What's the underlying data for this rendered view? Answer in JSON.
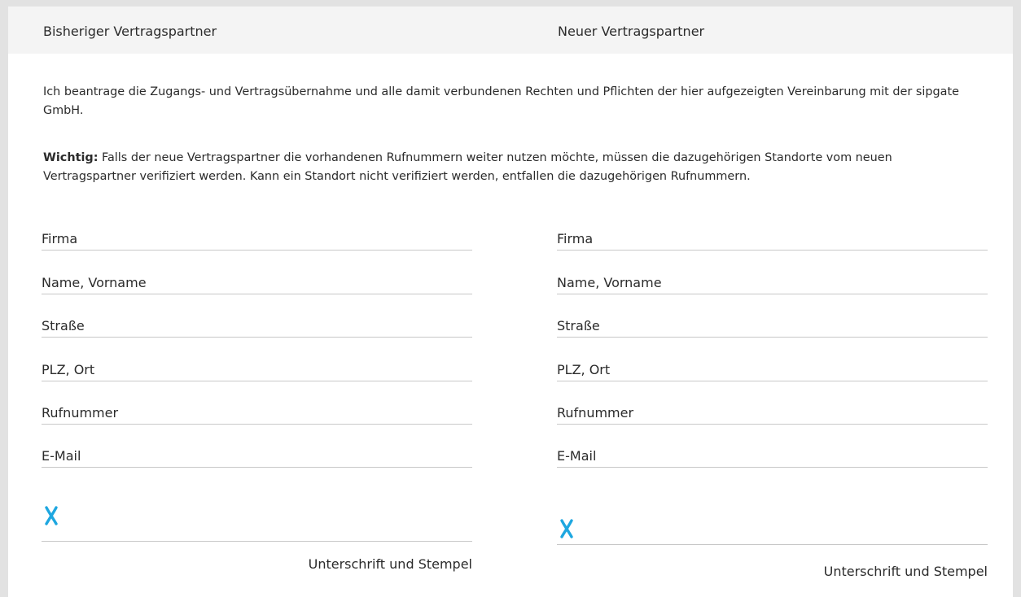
{
  "header": {
    "left_title": "Bisheriger Vertragspartner",
    "right_title": "Neuer Vertragspartner"
  },
  "intro": {
    "paragraph1": "Ich beantrage die Zugangs- und Vertragsübernahme und alle damit verbundenen Rechten und Pflichten der hier aufgezeigten Vereinbarung mit der sipgate GmbH.",
    "paragraph2_bold": "Wichtig:",
    "paragraph2_rest": " Falls der neue Vertragspartner die vorhandenen Rufnummern weiter nutzen möchte, müssen die dazugehörigen Standorte vom neuen Vertragspartner verifiziert werden. Kann ein Standort nicht verifiziert werden, entfallen die dazugehörigen Rufnummern."
  },
  "left_form": {
    "fields": [
      "Firma",
      "Name, Vorname",
      "Straße",
      "PLZ, Ort",
      "Rufnummer",
      "E-Mail"
    ],
    "signature_caption": "Unterschrift und Stempel"
  },
  "right_form": {
    "fields": [
      "Firma",
      "Name, Vorname",
      "Straße",
      "PLZ, Ort",
      "Rufnummer",
      "E-Mail"
    ],
    "signature_caption": "Unterschrift und Stempel"
  },
  "signature_mark": {
    "icon": "x-signature-mark-icon",
    "color": "#1ea7e0"
  }
}
